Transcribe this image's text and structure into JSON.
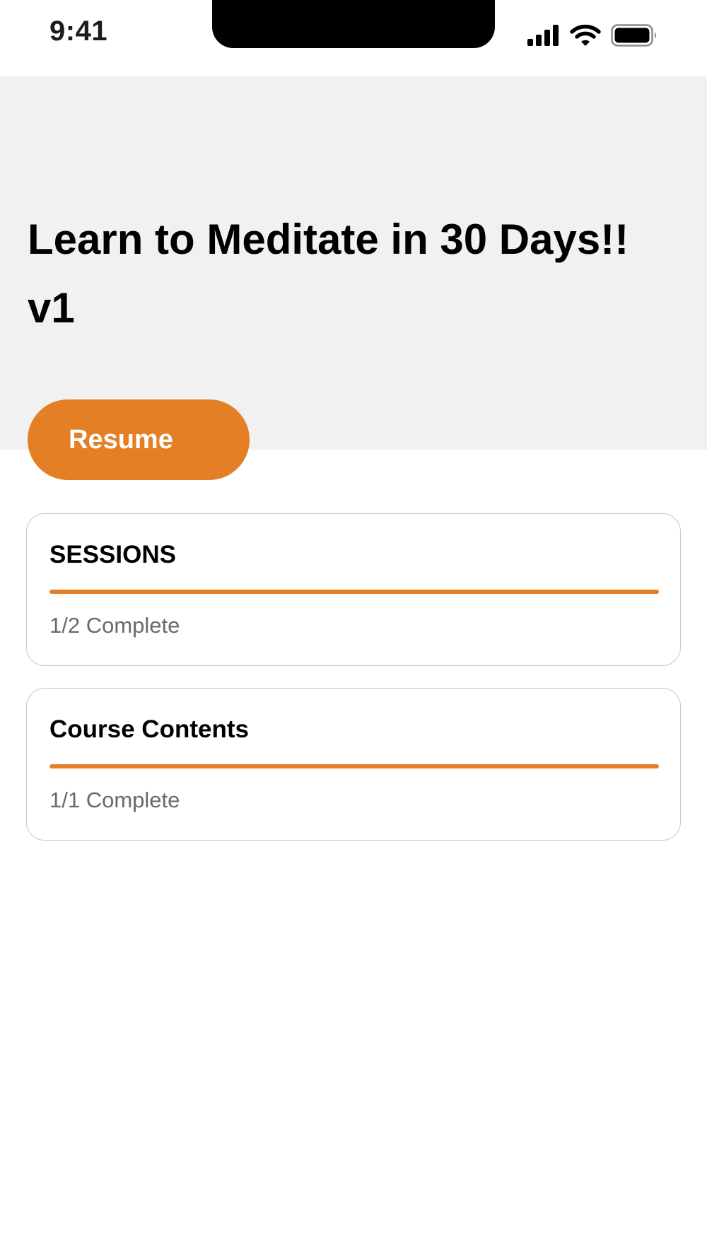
{
  "status_bar": {
    "time": "9:41",
    "icons": [
      "cellular-signal-icon",
      "wifi-icon",
      "battery-icon"
    ]
  },
  "course": {
    "title": "Learn to Meditate in 30 Days!! v1",
    "resume_label": "Resume"
  },
  "cards": [
    {
      "title": "SESSIONS",
      "status": "1/2 Complete",
      "progress": 1.0
    },
    {
      "title": "Course Contents",
      "status": "1/1 Complete",
      "progress": 1.0
    }
  ],
  "colors": {
    "accent": "#e47f25",
    "hero_background": "#f1f1f1",
    "card_border": "#c8c8c8",
    "muted_text": "#666a70"
  }
}
